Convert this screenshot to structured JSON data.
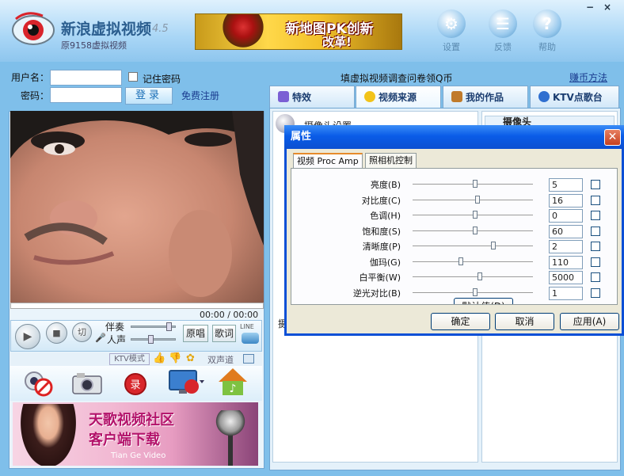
{
  "window": {
    "app_name": "新浪虚拟视频",
    "version": "4.5",
    "subtitle": "原9158虚拟视频",
    "minimize": "−",
    "close": "×"
  },
  "banner": {
    "line1": "新地图PK创新",
    "line2": "改革!"
  },
  "header_buttons": [
    {
      "label": "设置",
      "icon": "gear-icon"
    },
    {
      "label": "反馈",
      "icon": "list-icon"
    },
    {
      "label": "帮助",
      "icon": "question-icon"
    }
  ],
  "login": {
    "username_label": "用户名：",
    "username_value": "",
    "password_label": "密码：",
    "password_value": "",
    "remember_label": "记住密码",
    "login_button": "登录",
    "register_link": "免费注册"
  },
  "notice": {
    "survey_text": "填虚拟视频调查问卷领Q币",
    "earn_link": "赚币方法"
  },
  "tabs": [
    {
      "label": "特效",
      "active": false
    },
    {
      "label": "视频来源",
      "active": true
    },
    {
      "label": "我的作品",
      "active": false
    },
    {
      "label": "KTV点歌台",
      "active": false
    }
  ],
  "player": {
    "time": "00:00 / 00:00",
    "accompany_label": "伴奏",
    "voice_label": "人声",
    "cut_label": "切",
    "original_button": "原唱",
    "lyrics_button": "歌词",
    "line_label": "LINE",
    "ktv_mode": "KTV模式",
    "dual_channel": "双声道"
  },
  "ad": {
    "line1": "天歌视频社区",
    "line2": "客户端下载",
    "footer": "Tian Ge Video"
  },
  "right_panel": {
    "camera_settings_text": "摄像头设置",
    "camera_header": "摄像头",
    "partial_char": "摄"
  },
  "dialog": {
    "title": "属性",
    "tabs": [
      {
        "label": "视频 Proc Amp",
        "active": true
      },
      {
        "label": "照相机控制",
        "active": false
      }
    ],
    "properties": [
      {
        "label": "亮度(B)",
        "value": "5",
        "level": 0.52
      },
      {
        "label": "对比度(C)",
        "value": "16",
        "level": 0.54
      },
      {
        "label": "色调(H)",
        "value": "0",
        "level": 0.52
      },
      {
        "label": "饱和度(S)",
        "value": "60",
        "level": 0.52
      },
      {
        "label": "清晰度(P)",
        "value": "2",
        "level": 0.67
      },
      {
        "label": "伽玛(G)",
        "value": "110",
        "level": 0.4
      },
      {
        "label": "白平衡(W)",
        "value": "5000",
        "level": 0.56
      },
      {
        "label": "逆光对比(B)",
        "value": "1",
        "level": 0.52
      }
    ],
    "default_button": "默认值(D)",
    "ok_button": "确定",
    "cancel_button": "取消",
    "apply_button": "应用(A)",
    "colors": {
      "title_bar": "#0a5ce8",
      "close": "#c5401f"
    }
  }
}
